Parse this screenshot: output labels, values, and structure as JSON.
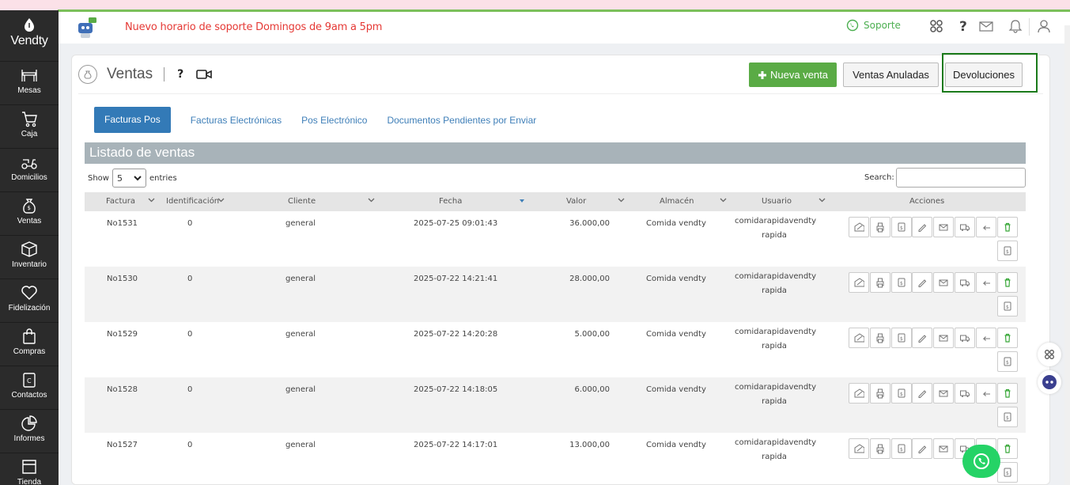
{
  "brand": {
    "name": "Vendty"
  },
  "sidebar": {
    "items": [
      {
        "label": "Mesas",
        "icon": "tables-icon"
      },
      {
        "label": "Caja",
        "icon": "cart-icon"
      },
      {
        "label": "Domicilios",
        "icon": "scooter-icon"
      },
      {
        "label": "Ventas",
        "icon": "money-bag-icon"
      },
      {
        "label": "Inventario",
        "icon": "box-icon"
      },
      {
        "label": "Fidelización",
        "icon": "heart-icon"
      },
      {
        "label": "Compras",
        "icon": "shopping-bag-icon"
      },
      {
        "label": "Contactos",
        "icon": "contacts-icon"
      },
      {
        "label": "Informes",
        "icon": "pie-chart-icon"
      },
      {
        "label": "Tienda",
        "icon": "store-icon"
      }
    ]
  },
  "header": {
    "notice": "Nuevo horario de soporte Domingos de 9am a 5pm",
    "support_label": "Soporte"
  },
  "page": {
    "title": "Ventas",
    "help": "?",
    "buttons": {
      "new_sale": "Nueva venta",
      "voided": "Ventas Anuladas",
      "returns": "Devoluciones"
    },
    "tabs": [
      "Facturas Pos",
      "Facturas Electrónicas",
      "Pos Electrónico",
      "Documentos Pendientes por Enviar"
    ],
    "list_title": "Listado de ventas",
    "show_label": "Show",
    "entries_value": "5",
    "entries_label": "entries",
    "search_label": "Search:"
  },
  "table": {
    "columns": [
      "Factura",
      "Identificación",
      "Cliente",
      "Fecha",
      "Valor",
      "Almacén",
      "Usuario",
      "Acciones"
    ],
    "rows": [
      {
        "factura": "No1531",
        "id": "0",
        "cliente": "general",
        "fecha": "2025-07-25 09:01:43",
        "valor": "36.000,00",
        "almacen": "Comida vendty",
        "usuario1": "comidarapidavendty",
        "usuario2": "rapida"
      },
      {
        "factura": "No1530",
        "id": "0",
        "cliente": "general",
        "fecha": "2025-07-22 14:21:41",
        "valor": "28.000,00",
        "almacen": "Comida vendty",
        "usuario1": "comidarapidavendty",
        "usuario2": "rapida"
      },
      {
        "factura": "No1529",
        "id": "0",
        "cliente": "general",
        "fecha": "2025-07-22 14:20:28",
        "valor": "5.000,00",
        "almacen": "Comida vendty",
        "usuario1": "comidarapidavendty",
        "usuario2": "rapida"
      },
      {
        "factura": "No1528",
        "id": "0",
        "cliente": "general",
        "fecha": "2025-07-22 14:18:05",
        "valor": "6.000,00",
        "almacen": "Comida vendty",
        "usuario1": "comidarapidavendty",
        "usuario2": "rapida"
      },
      {
        "factura": "No1527",
        "id": "0",
        "cliente": "general",
        "fecha": "2025-07-22 14:17:01",
        "valor": "13.000,00",
        "almacen": "Comida vendty",
        "usuario1": "comidarapidavendty",
        "usuario2": "rapida"
      }
    ]
  },
  "colors": {
    "accent_green": "#5aab45",
    "tab_blue": "#337ab7",
    "notice_red": "#e53935",
    "sidebar_bg": "#2b2b2b"
  }
}
